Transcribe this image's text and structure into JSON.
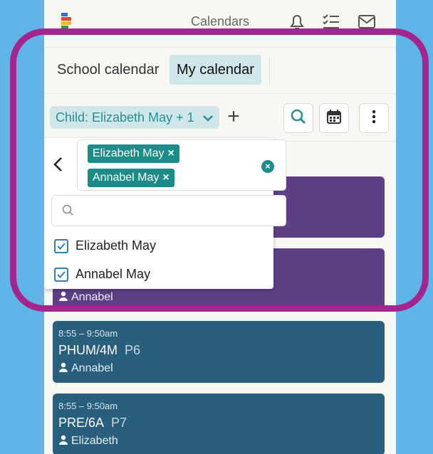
{
  "colors": {
    "accent": "#2a8f92",
    "highlight": "#a5258e",
    "event_purple": "#5e3f85",
    "event_blue": "#285f7c"
  },
  "header": {
    "title": "Calendars",
    "icons": [
      "bell-icon",
      "checklist-icon",
      "mail-icon"
    ]
  },
  "tabs": [
    {
      "label": "School calendar",
      "active": false
    },
    {
      "label": "My calendar",
      "active": true
    }
  ],
  "filter": {
    "child_label": "Child: Elizabeth May + 1"
  },
  "dropdown": {
    "chips": [
      "Elizabeth May",
      "Annabel May"
    ],
    "search_placeholder": "",
    "options": [
      {
        "label": "Elizabeth May",
        "checked": true
      },
      {
        "label": "Annabel May",
        "checked": true
      }
    ]
  },
  "events": [
    {
      "time": "",
      "title": "",
      "room": "",
      "person": ""
    },
    {
      "time": "",
      "title": "",
      "room": "",
      "person": "Annabel"
    },
    {
      "time": "8:55 – 9:50am",
      "title": "PHUM/4M",
      "room": "P6",
      "person": "Annabel"
    },
    {
      "time": "8:55 – 9:50am",
      "title": "PRE/6A",
      "room": "P7",
      "person": "Elizabeth"
    }
  ]
}
